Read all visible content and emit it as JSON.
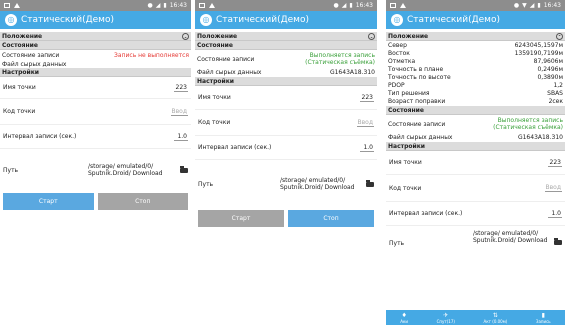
{
  "status_time": "16:43",
  "app_title": "Статический(Демо)",
  "labels": {
    "position": "Положение",
    "state": "Состояние",
    "settings": "Настройки",
    "record_state": "Состояние записи",
    "raw_file": "Файл сырых данных",
    "point_name": "Имя точки",
    "point_code": "Код точки",
    "interval": "Интервал записи (сек.)",
    "path": "Путь",
    "north": "Север",
    "east": "Восток",
    "elev": "Отметка",
    "hprec": "Точность в плане",
    "vprec": "Точность по высоте",
    "pdop": "PDOP",
    "sol": "Тип решения",
    "age": "Возраст поправки"
  },
  "values": {
    "record_off": "Запись не выполняется",
    "record_on": "Выполняется запись (Статическая съёмка)",
    "raw_file": "G1643A18.310",
    "point_name": "223",
    "point_code_placeholder": "Ввод",
    "interval": "1.0",
    "path": "/storage/ emulated/0/ Sputnik.Droid/ Download",
    "north": "6243045,1597м",
    "east": "1359190,7199м",
    "elev": "87,9606м",
    "hprec": "0,2496м",
    "vprec": "0,3890м",
    "pdop": "1,2",
    "sol": "SBAS",
    "age": "2сек"
  },
  "buttons": {
    "start": "Старт",
    "stop": "Стоп"
  },
  "nav": [
    "Аки",
    "Спут(17)",
    "Акт (0.00м)",
    "Запись"
  ],
  "colors": {
    "appbar": "#45a9e4",
    "status_red": "#e53935",
    "status_green": "#3aa03a"
  }
}
